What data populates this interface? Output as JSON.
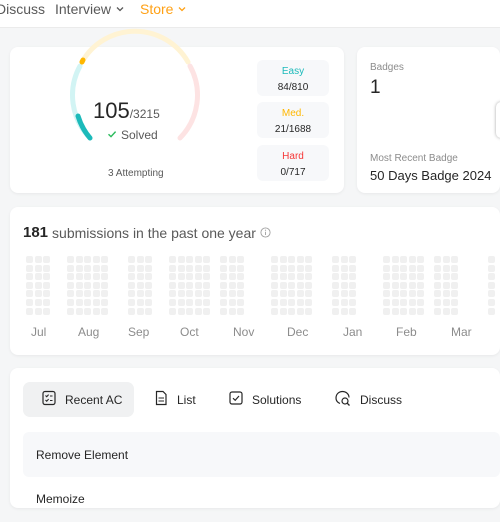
{
  "nav": {
    "items": [
      {
        "label": "Discuss",
        "active": false,
        "has_chevron": false
      },
      {
        "label": "Interview",
        "active": false,
        "has_chevron": true
      },
      {
        "label": "Store",
        "active": true,
        "has_chevron": true
      }
    ]
  },
  "progress": {
    "solved": "105",
    "total": "/3215",
    "solved_label": "Solved",
    "attempting": "3 Attempting",
    "difficulties": [
      {
        "name": "Easy",
        "value": "84/810",
        "color": "#1cbaba"
      },
      {
        "name": "Med.",
        "value": "21/1688",
        "color": "#ffb700"
      },
      {
        "name": "Hard",
        "value": "0/717",
        "color": "#f63737"
      }
    ]
  },
  "badges": {
    "label": "Badges",
    "count": "1",
    "recent_label": "Most Recent Badge",
    "recent_name": "50 Days Badge 2024"
  },
  "submissions": {
    "count": "181",
    "label": "submissions in the past one year",
    "months": [
      "Jul",
      "Aug",
      "Sep",
      "Oct",
      "Nov",
      "Dec",
      "Jan",
      "Feb",
      "Mar"
    ]
  },
  "tabs": [
    {
      "label": "Recent AC",
      "icon": "recent-ac-icon",
      "active": true
    },
    {
      "label": "List",
      "icon": "list-icon",
      "active": false
    },
    {
      "label": "Solutions",
      "icon": "solutions-icon",
      "active": false
    },
    {
      "label": "Discuss",
      "icon": "discuss-icon",
      "active": false
    }
  ],
  "recent": [
    {
      "title": "Remove Element"
    },
    {
      "title": "Memoize"
    }
  ],
  "colors": {
    "accent": "#ffa116",
    "easy": "#1cbaba",
    "medium": "#ffb700",
    "hard": "#f63737"
  }
}
